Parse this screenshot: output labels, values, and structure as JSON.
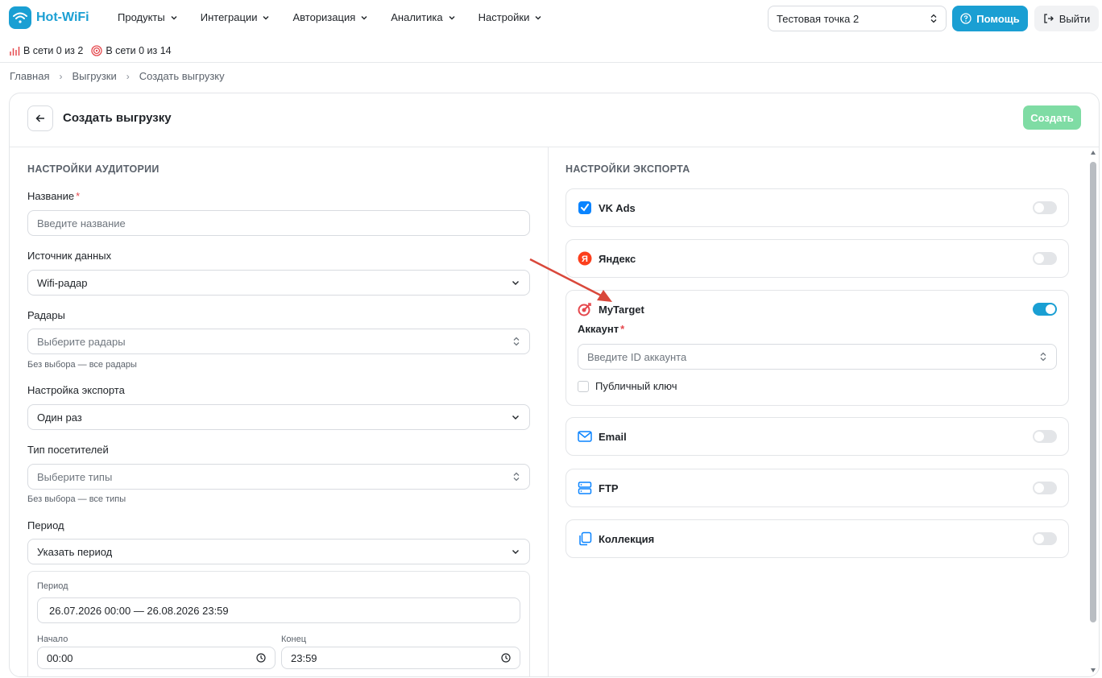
{
  "app": {
    "logo_text": "Hot-WiFi",
    "brand_color": "#1a9fd3"
  },
  "nav": {
    "items": [
      {
        "label": "Продукты"
      },
      {
        "label": "Интеграции"
      },
      {
        "label": "Авторизация"
      },
      {
        "label": "Аналитика"
      },
      {
        "label": "Настройки"
      }
    ]
  },
  "header": {
    "point_select_value": "Тестовая точка 2",
    "help_label": "Помощь",
    "logout_label": "Выйти"
  },
  "status": {
    "online_points": "В сети 0 из 2",
    "online_radars": "В сети 0 из 14"
  },
  "breadcrumb": {
    "items": [
      "Главная",
      "Выгрузки",
      "Создать выгрузку"
    ]
  },
  "page": {
    "title": "Создать выгрузку",
    "create_label": "Создать"
  },
  "audience": {
    "section_title": "НАСТРОЙКИ АУДИТОРИИ",
    "name_label": "Название",
    "name_placeholder": "Введите название",
    "source_label": "Источник данных",
    "source_value": "Wifi-радар",
    "radars_label": "Радары",
    "radars_placeholder": "Выберите радары",
    "radars_hint": "Без выбора — все радары",
    "export_setting_label": "Настройка экспорта",
    "export_setting_value": "Один раз",
    "visitor_type_label": "Тип посетителей",
    "visitor_type_placeholder": "Выберите типы",
    "visitor_type_hint": "Без выбора — все типы",
    "period_label": "Период",
    "period_value": "Указать период",
    "period_box": {
      "label": "Период",
      "range": "26.07.2026 00:00 — 26.08.2026 23:59",
      "start_label": "Начало",
      "start_value": "00:00",
      "end_label": "Конец",
      "end_value": "23:59"
    }
  },
  "export": {
    "section_title": "НАСТРОЙКИ ЭКСПОРТА",
    "vk": {
      "label": "VK Ads",
      "enabled": false
    },
    "yandex": {
      "label": "Яндекс",
      "enabled": false
    },
    "mytarget": {
      "label": "MyTarget",
      "enabled": true,
      "account_label": "Аккаунт",
      "account_placeholder": "Введите ID аккаунта",
      "public_key_label": "Публичный ключ",
      "public_key_checked": false
    },
    "email": {
      "label": "Email",
      "enabled": false
    },
    "ftp": {
      "label": "FTP",
      "enabled": false
    },
    "collection": {
      "label": "Коллекция",
      "enabled": false
    }
  }
}
